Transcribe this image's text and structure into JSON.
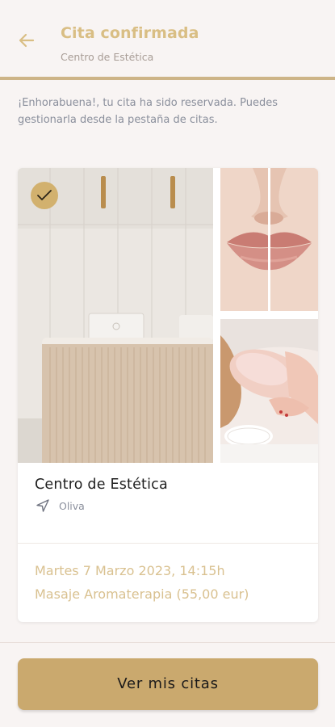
{
  "header": {
    "title": "Cita confirmada",
    "subtitle": "Centro de Estética",
    "back_icon": "arrow-left-icon"
  },
  "message": "¡Enhorabuena!, tu cita ha sido reservada. Puedes gestionarla desde la pestaña de citas.",
  "card": {
    "center_name": "Centro de Estética",
    "location": "Oliva",
    "location_icon": "navigation-arrow-icon",
    "check_icon": "checkmark-icon",
    "appointment_date": "Martes 7 Marzo 2023, 14:15h",
    "service": "Masaje Aromaterapia (55,00 eur)"
  },
  "cta": {
    "label": "Ver mis citas"
  },
  "colors": {
    "accent": "#caa96e",
    "title_gold": "#d9be84",
    "background": "#f8f4f3",
    "muted_text": "#8a8f9c"
  }
}
